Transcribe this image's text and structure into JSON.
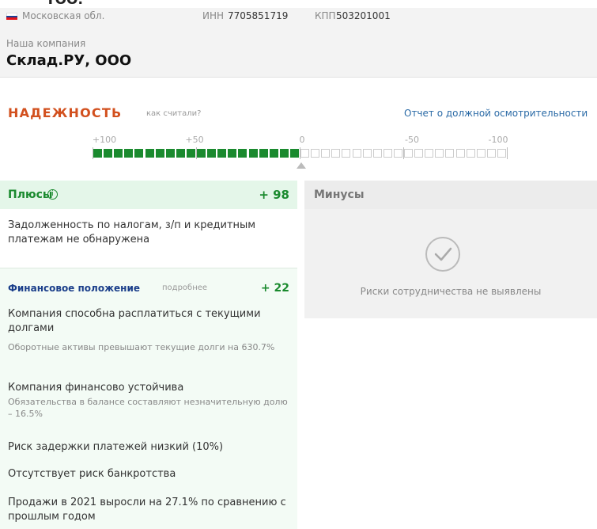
{
  "header": {
    "top_cut_text": "ТОО.",
    "region": "Московская обл.",
    "inn_label": "ИНН",
    "inn_value": "7705851719",
    "kpp_label": "КПП",
    "kpp_value": "503201001",
    "our_company": "Наша компания",
    "company_name": "Склад.РУ, ООО",
    "flag_colors": [
      "#ffffff",
      "#1c3f95",
      "#e3141a"
    ]
  },
  "reliability": {
    "title": "НАДЕЖНОСТЬ",
    "how_link": "как считали?",
    "report_link": "Отчет о должной осмотрительности",
    "ticks": [
      "+100",
      "+50",
      "0",
      "-50",
      "-100"
    ],
    "score": 98,
    "scale_min": -100,
    "scale_max": 100,
    "accent_color": "#d2501e",
    "positive_color": "#1a8a2e"
  },
  "pluses": {
    "title": "Плюсы",
    "info_icon": "info-circle-icon",
    "score": "+ 98",
    "no_debt": "Задолженность по налогам, з/п и кредитным платежам не обнаружена",
    "finance": {
      "title": "Финансовое положение",
      "more_link": "подробнее",
      "score": "+ 22",
      "items": [
        {
          "text": "Компания способна расплатиться с текущими долгами",
          "sub": "Оборотные активы превышают текущие долги на 630.7%"
        },
        {
          "text": "Компания финансово устойчива",
          "sub": "Обязательства в балансе составляют незначительную долю – 16.5%"
        },
        {
          "text": "Риск задержки платежей низкий (10%)",
          "sub": ""
        },
        {
          "text": "Отсутствует риск банкротства",
          "sub": ""
        },
        {
          "text": "Продажи в 2021 выросли на 27.1% по сравнению с прошлым годом",
          "sub": ""
        }
      ]
    }
  },
  "minuses": {
    "title": "Минусы",
    "icon": "check-circle-icon",
    "note": "Риски сотрудничества не выявлены"
  }
}
